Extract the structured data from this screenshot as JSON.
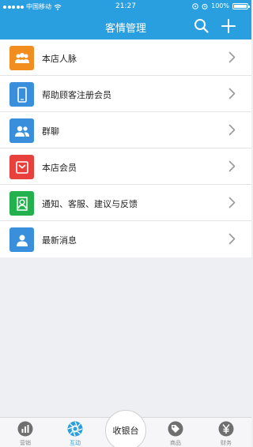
{
  "status_bar": {
    "carrier": "中国移动",
    "time": "21:27",
    "battery": "100%"
  },
  "header": {
    "title": "客情管理",
    "icons": [
      "search-icon",
      "plus-icon"
    ]
  },
  "menu": [
    {
      "label": "本店人脉",
      "icon": "contacts-icon",
      "color": "#f28e1f"
    },
    {
      "label": "帮助顾客注册会员",
      "icon": "phone-icon",
      "color": "#3a8fdc"
    },
    {
      "label": "群聊",
      "icon": "group-chat-icon",
      "color": "#3a8fdc"
    },
    {
      "label": "本店会员",
      "icon": "member-card-icon",
      "color": "#e8413d"
    },
    {
      "label": "通知、客服、建议与反馈",
      "icon": "service-icon",
      "color": "#22b14c"
    },
    {
      "label": "最新消息",
      "icon": "person-icon",
      "color": "#3a8fdc"
    }
  ],
  "tabbar": {
    "tabs": [
      {
        "label": "营销",
        "icon": "chart-icon"
      },
      {
        "label": "互动",
        "icon": "aperture-icon",
        "active": true
      },
      {
        "label": "商品",
        "icon": "tag-icon"
      },
      {
        "label": "财务",
        "icon": "yen-icon"
      }
    ],
    "center_button": "收银台"
  },
  "colors": {
    "accent": "#2a9fdf",
    "background": "#eeeff3"
  }
}
